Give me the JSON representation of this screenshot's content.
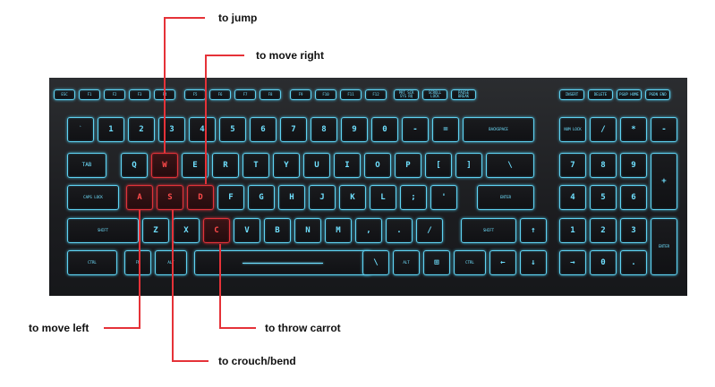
{
  "labels": {
    "jump": "to jump",
    "move_right": "to move right",
    "move_left": "to move left",
    "throw_carrot": "to throw carrot",
    "crouch": "to crouch/bend"
  },
  "highlight_color": "#e53238",
  "backlight_color": "#5fd2f2",
  "keys": {
    "esc": "ESC",
    "f1": "F1",
    "f2": "F2",
    "f3": "F3",
    "f4": "F4",
    "f5": "F5",
    "f6": "F6",
    "f7": "F7",
    "f8": "F8",
    "f9": "F9",
    "f10": "F10",
    "f11": "F11",
    "f12": "F12",
    "prtscr": "PRT SCR SYS RQ",
    "scroll": "SCROLL LOCK",
    "pause": "PAUSE BREAK",
    "insert": "INSERT",
    "delete": "DELETE",
    "pgup": "PGUP HOME",
    "pgdn": "PGDN END",
    "tilde": "`",
    "n1": "1",
    "n2": "2",
    "n3": "3",
    "n4": "4",
    "n5": "5",
    "n6": "6",
    "n7": "7",
    "n8": "8",
    "n9": "9",
    "n0": "0",
    "minus": "-",
    "equals": "=",
    "backspace": "BACKSPACE",
    "numlock": "NUM LOCK",
    "np_slash": "/",
    "np_star": "*",
    "np_minus": "-",
    "tab": "TAB",
    "q": "Q",
    "w": "W",
    "e": "E",
    "r": "R",
    "t": "T",
    "y": "Y",
    "u": "U",
    "i": "I",
    "o": "O",
    "p": "P",
    "lbracket": "[",
    "rbracket": "]",
    "backslash": "\\",
    "np7": "7",
    "np8": "8",
    "np9": "9",
    "np_plus": "+",
    "caps": "CAPS LOCK",
    "a": "A",
    "s": "S",
    "d": "D",
    "f": "F",
    "g": "G",
    "h": "H",
    "j": "J",
    "k": "K",
    "l": "L",
    "semicolon": ";",
    "quote": "'",
    "enter": "ENTER",
    "np4": "4",
    "np5": "5",
    "np6": "6",
    "lshift": "SHIFT",
    "z": "Z",
    "x": "X",
    "c": "C",
    "v": "V",
    "b": "B",
    "n": "N",
    "m": "M",
    "comma": ",",
    "period": ".",
    "slash": "/",
    "rshift": "SHIFT",
    "up": "↑",
    "np1": "1",
    "np2": "2",
    "np3": "3",
    "np_enter": "ENTER",
    "lctrl": "CTRL",
    "fn": "FN",
    "lalt": "ALT",
    "space": "",
    "grave2": "\\",
    "ralt": "ALT",
    "win": "⊞",
    "rctrl": "CTRL",
    "left": "←",
    "down": "↓",
    "right": "→",
    "np0": "0",
    "np_dot": "."
  }
}
